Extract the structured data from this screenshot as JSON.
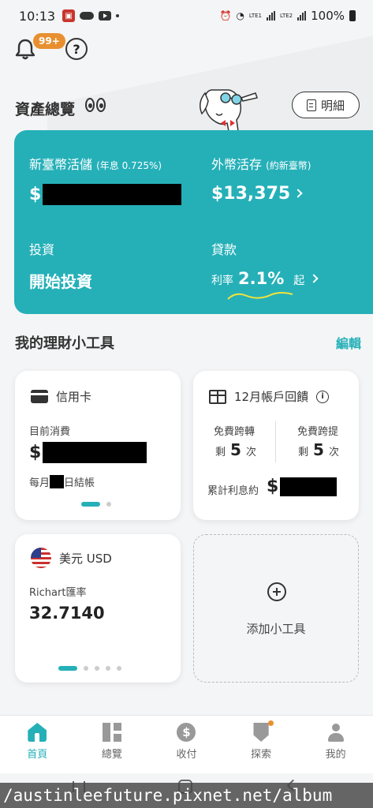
{
  "status_bar": {
    "time": "10:13",
    "lte1": "LTE1",
    "lte2": "LTE2",
    "battery": "100%"
  },
  "header": {
    "badge": "99+",
    "help": "?"
  },
  "overview": {
    "title": "資產總覽",
    "detail_label": "明細"
  },
  "assets": {
    "twd_label": "新臺幣活儲",
    "twd_rate": "(年息 0.725%)",
    "twd_currency": "$",
    "fx_label": "外幣活存",
    "fx_note": "(約新臺幣)",
    "fx_amount": "$13,375",
    "invest_label": "投資",
    "invest_action": "開始投資",
    "loan_label": "貸款",
    "loan_rate_prefix": "利率",
    "loan_rate": "2.1%",
    "loan_rate_suffix": "起"
  },
  "tools": {
    "title": "我的理財小工具",
    "edit": "編輯",
    "credit_card": {
      "title": "信用卡",
      "spend_label": "目前消費",
      "currency": "$",
      "billing_prefix": "每月",
      "billing_suffix": "日結帳"
    },
    "rewards": {
      "title": "12月帳戶回饋",
      "transfer_label": "免費跨轉",
      "withdraw_label": "免費跨提",
      "remain": "剩",
      "transfer_count": "5",
      "withdraw_count": "5",
      "unit": "次",
      "interest_label": "累計利息約",
      "currency": "$"
    },
    "fx": {
      "title": "美元 USD",
      "rate_label": "Richart匯率",
      "rate": "32.7140"
    },
    "add": {
      "label": "添加小工具"
    }
  },
  "nav": [
    {
      "label": "首頁",
      "icon": "home-icon"
    },
    {
      "label": "總覽",
      "icon": "overview-icon"
    },
    {
      "label": "收付",
      "icon": "payment-icon"
    },
    {
      "label": "探索",
      "icon": "explore-icon"
    },
    {
      "label": "我的",
      "icon": "profile-icon"
    }
  ],
  "nav_pay_glyph": "$",
  "watermark": "/austinleefuture.pixnet.net/album",
  "colors": {
    "accent": "#25b0b8",
    "badge": "#e8902f",
    "redaction": "#000000"
  }
}
